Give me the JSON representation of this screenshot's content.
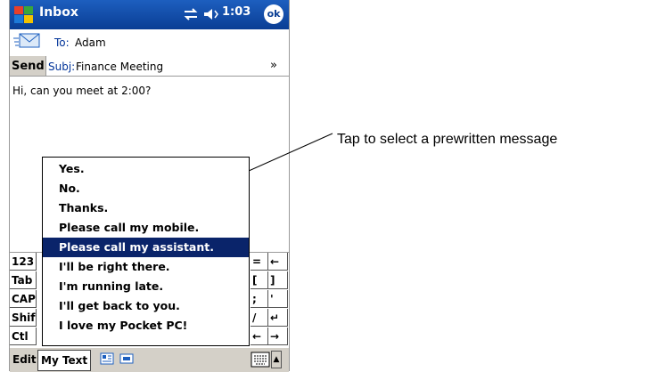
{
  "status_bar": {
    "title": "Inbox",
    "time": "1:03",
    "ok_label": "ok"
  },
  "header": {
    "send_label": "Send",
    "to_label": "To:",
    "to_value": "Adam",
    "subj_label": "Subj:",
    "subj_value": "Finance Meeting",
    "expand_glyph": "»"
  },
  "message_body": "Hi, can you meet at 2:00?",
  "my_text_list": {
    "items": [
      "Yes.",
      "No.",
      "Thanks.",
      "Please call my mobile.",
      "Please call my assistant.",
      "I'll be right there.",
      "I'm running late.",
      "I'll get back to you.",
      "I love my Pocket PC!"
    ],
    "selected_index": 4
  },
  "keyboard": {
    "left_keys": [
      "123",
      "Tab",
      "CAP",
      "Shif",
      "Ctl"
    ],
    "right_keys": [
      "=",
      "←",
      "[",
      "]",
      ";",
      "'",
      "/",
      "↵",
      "←",
      "→"
    ]
  },
  "menu_bar": {
    "edit_label": "Edit",
    "my_text_label": "My Text"
  },
  "callout": {
    "text": "Tap to select a prewritten message"
  },
  "colors": {
    "title_bar": "#0a3e94",
    "selection": "#0a246a",
    "menu_bar": "#d4d0c8"
  }
}
